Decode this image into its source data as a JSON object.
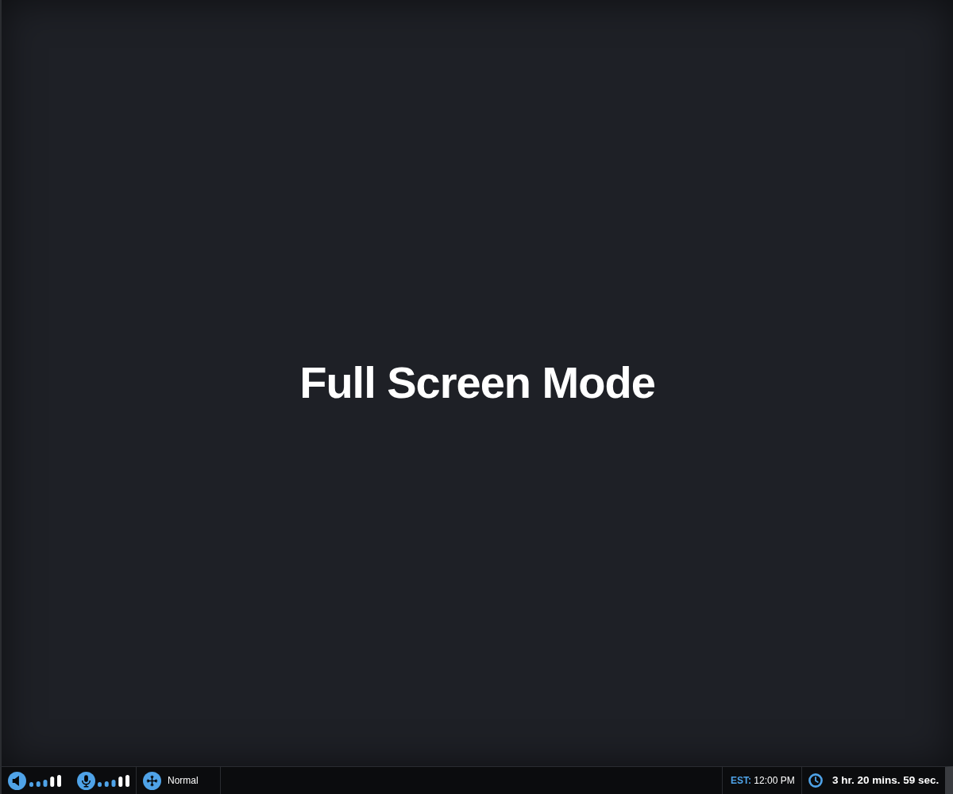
{
  "main": {
    "title": "Full Screen Mode"
  },
  "status_bar": {
    "view_mode": "Normal",
    "timezone": {
      "label": "EST:",
      "time": "12:00 PM"
    },
    "timer": "3 hr. 20 mins. 59 sec."
  }
}
